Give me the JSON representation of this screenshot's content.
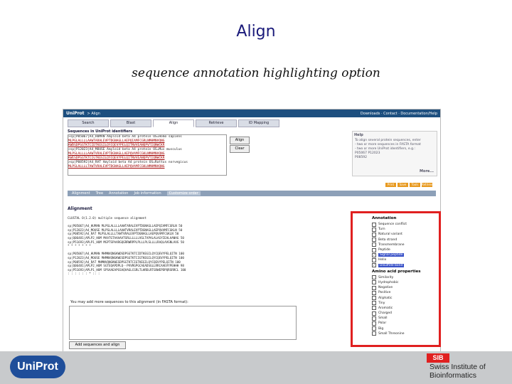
{
  "slide": {
    "title": "Align",
    "subtitle": "sequence annotation highlighting option"
  },
  "screenshot": {
    "topbar": {
      "logo": "UniProt",
      "crumb": "> Align",
      "links": "Downloads · Contact · Documentation/Help"
    },
    "tabs": [
      "Search",
      "Blast",
      "Align",
      "Retrieve",
      "ID Mapping"
    ],
    "sequence_label": "Sequences in UniProt identifiers",
    "sequence_lines": [
      ">sp|P05067|A4_HUMAN Amyloid beta A4 protein OS=Homo sapiens",
      "MLPGLALLLLAAWTARALEVPTDGNAGLLAEPQIAMFCGRLNMHMNVQNG",
      "KWDSDPSGTKTCIDTKEGILQYCQEVYPELQITNVVEANQPVTIQNWCKR",
      ">sp|P12023|A4_MOUSE Amyloid beta A4 protein OS=Mus musculus",
      "MLPSLALLLLAAWTVRALEVPTDGNAGLLAEPQVAMFCGKLNMHMNVQNG",
      "KWESDPSGTKTCIGTKEGILQYCQEVYPELQITNVVEANQPVTIQNWCKR",
      ">sp|P08592|A4_RAT Amyloid beta A4 protein OS=Rattus norvegicus",
      "MLPSLALLLLTAWTVRALEVPTDGNAGLLAEPQVAMFCGKLNMHMNVQNG"
    ],
    "align_button": "Align",
    "clear_button": "Clear",
    "help": {
      "title": "Help",
      "lines": [
        "To align several protein sequences, enter",
        "- two or more sequences in FASTA format",
        "- two or more UniProt identifiers, e.g.:",
        "  P05067 P12023",
        "  P08592"
      ],
      "more": "More..."
    },
    "orange_buttons": [
      "Print",
      "Save",
      "Tools",
      "Retrieve"
    ],
    "results_tabs": [
      "Alignment",
      "Tree",
      "Annotation",
      "Job information",
      "Customize order"
    ],
    "alignment_title": "Alignment",
    "alignment_lines": [
      "CLUSTAL O(1.2.0) multiple sequence alignment",
      "",
      "sp|P05067|A4_HUMAN   MLPGLALLLLAAWTARALEVPTDGNAGLLAEPQIAMFCGRLN  50",
      "sp|P12023|A4_MOUSE   MLPSLALLLLAAWTVRALEVPTDGNAGLLAEPQVAMFCGKLN  50",
      "sp|P08592|A4_RAT     MLPSLALLLLTAWTVRALEVPTDGNAGLLAEPQVAMFCGKLN  50",
      "sp|Q06481|APLP2_HUM  MAATGTAAAAATGRLLLLLLVGLTAPALALAGYIEALAANAG  50",
      "sp|P51693|APLP1_HUM  MGPTSPAARGQGRRWRPPLPLLLPLSLLLLRAQLAVGNLAVG  50",
      "                     *    *        *  *    *   *           *",
      "",
      "sp|P05067|A4_HUMAN   MHMNVQNGKWDSDPSGTKTCIDTKEGILQYCQEVYPELQITN  100",
      "sp|P12023|A4_MOUSE   MHMNVQNGKWESDPSGTKTCIGTKEGILQYCQEVYPELQITN  100",
      "sp|P08592|A4_RAT     MHMNVQNGKWESDPSGTKTCIGTKEGILQYCQEVYPELQITN  100",
      "sp|Q06481|APLP2_HUM  SGTEQAPDPLQ--PVVRGPGCAEADSGLLRRCAAEVYPEHHH  98",
      "sp|P51693|APLP1_HUM  SPSAAEAPGSAQVAGLCGRLTLHRDLRTGRWEPDPQRSRRCL  100",
      "                     :    :  :      :      :  :  *  ::  :"
    ],
    "add_note": "You may add more sequences to this alignment (in FASTA format):",
    "add_button": "Add sequences and align",
    "panel": {
      "annotation_header": "Annotation",
      "annotation_items": [
        {
          "label": "Sequence conflict",
          "checked": false
        },
        {
          "label": "Turn",
          "checked": false
        },
        {
          "label": "Natural variant",
          "checked": false
        },
        {
          "label": "Beta strand",
          "checked": false
        },
        {
          "label": "Transmembrane",
          "checked": false
        },
        {
          "label": "Peptide",
          "checked": false
        },
        {
          "label": "Signal peptide",
          "checked": true
        },
        {
          "label": "Helix",
          "checked": false
        },
        {
          "label": "Disulfide bond",
          "checked": true
        }
      ],
      "aa_header": "Amino acid properties",
      "aa_items": [
        {
          "label": "Similarity",
          "checked": false
        },
        {
          "label": "Hydrophobic",
          "checked": false
        },
        {
          "label": "Negative",
          "checked": false
        },
        {
          "label": "Positive",
          "checked": false
        },
        {
          "label": "Aliphatic",
          "checked": false
        },
        {
          "label": "Tiny",
          "checked": false
        },
        {
          "label": "Aromatic",
          "checked": false
        },
        {
          "label": "Charged",
          "checked": false
        },
        {
          "label": "Small",
          "checked": false
        },
        {
          "label": "Polar",
          "checked": false
        },
        {
          "label": "Big",
          "checked": false
        },
        {
          "label": "Small Threonine",
          "checked": false
        }
      ]
    }
  },
  "footer": {
    "uniprot_logo": "UniProt",
    "sib_badge": "SIB",
    "sib_line1": "Swiss Institute of",
    "sib_line2": "Bioinformatics"
  },
  "colors": {
    "accent_red": "#e02020",
    "brand_blue": "#1f4e9a",
    "highlight": "#3a52c8"
  }
}
